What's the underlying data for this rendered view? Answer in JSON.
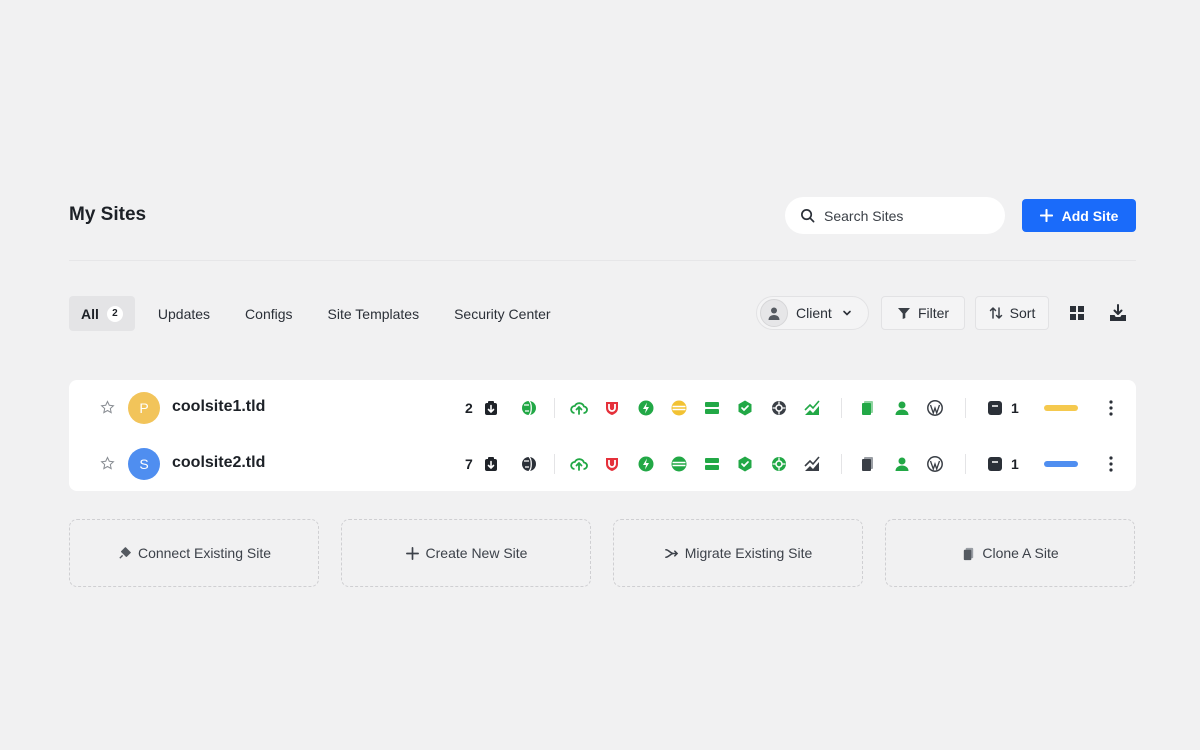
{
  "page": {
    "title": "My Sites"
  },
  "search": {
    "placeholder": "Search Sites",
    "value": ""
  },
  "add_button": {
    "label": "Add Site"
  },
  "tabs": [
    {
      "label": "All",
      "count": "2",
      "active": true
    },
    {
      "label": "Updates"
    },
    {
      "label": "Configs"
    },
    {
      "label": "Site Templates"
    },
    {
      "label": "Security Center"
    }
  ],
  "controls": {
    "client_label": "Client",
    "filter_label": "Filter",
    "sort_label": "Sort"
  },
  "sites": [
    {
      "initial": "P",
      "name": "coolsite1.tld",
      "avatar_color": "#f2c45a",
      "updates": "2",
      "users": "1",
      "tag_color": "#f5c94e"
    },
    {
      "initial": "S",
      "name": "coolsite2.tld",
      "avatar_color": "#4f8ef0",
      "updates": "7",
      "users": "1",
      "tag_color": "#4f8ef0"
    }
  ],
  "actions": [
    {
      "label": "Connect Existing Site",
      "icon": "plug-icon"
    },
    {
      "label": "Create New Site",
      "icon": "plus-icon"
    },
    {
      "label": "Migrate Existing Site",
      "icon": "migrate-icon"
    },
    {
      "label": "Clone A Site",
      "icon": "copy-icon"
    }
  ],
  "colors": {
    "accent": "#1a6bfa",
    "ok": "#22a846",
    "warn": "#f2c233",
    "danger": "#e5303a"
  }
}
